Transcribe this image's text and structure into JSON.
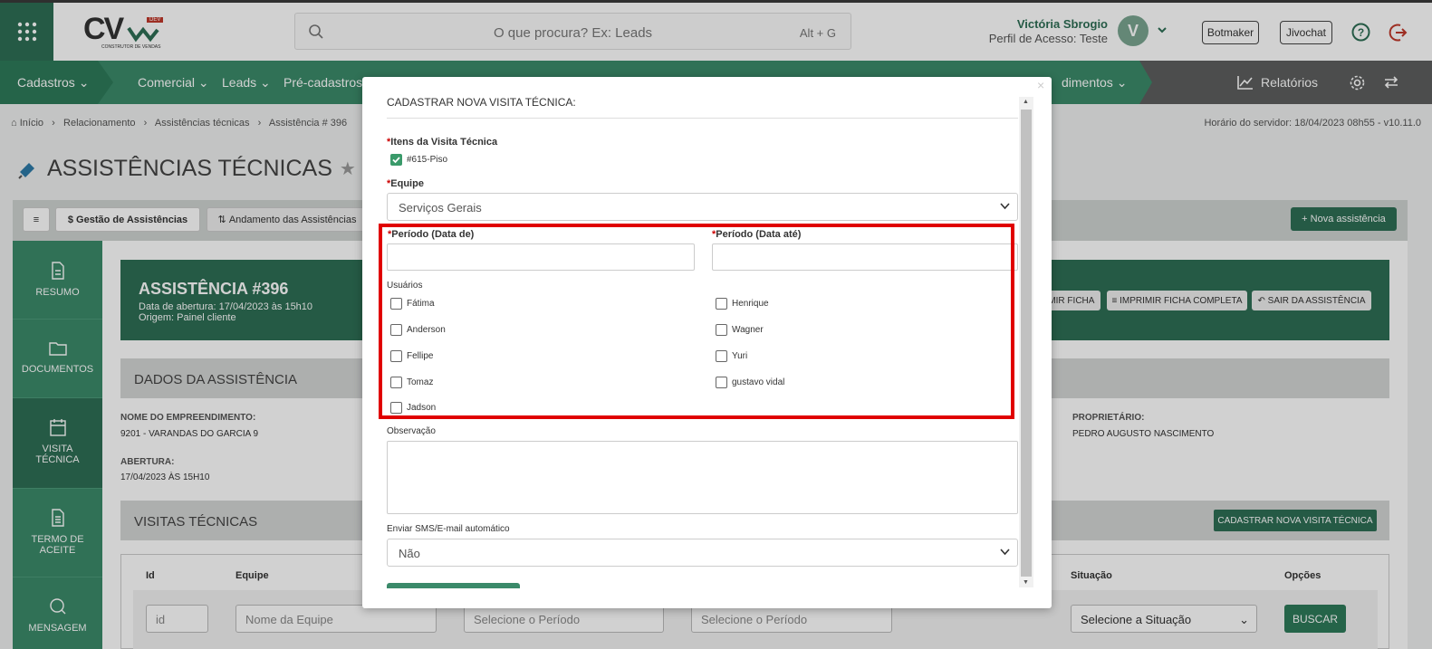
{
  "header": {
    "logo_text": "CV",
    "logo_tag": "DEV",
    "logo_sub": "CONSTRUTOR DE VENDAS",
    "search_placeholder": "O que procura? Ex: Leads",
    "search_shortcut": "Alt + G",
    "user_name": "Victória Sbrogio",
    "user_profile": "Perfil de Acesso: Teste",
    "avatar_letter": "V",
    "btn_botmaker": "Botmaker",
    "btn_jivochat": "Jivochat"
  },
  "nav": {
    "cadastros": "Cadastros",
    "comercial": "Comercial",
    "leads": "Leads",
    "precadastros": "Pré-cadastros",
    "atendimentos": "dimentos",
    "relatorios": "Relatórios"
  },
  "breadcrumb": {
    "items": [
      "Início",
      "Relacionamento",
      "Assistências técnicas",
      "Assistência # 396"
    ],
    "server_time": "Horário do servidor: 18/04/2023 08h55 - v10.11.0"
  },
  "page": {
    "title": "ASSISTÊNCIAS TÉCNICAS"
  },
  "toolbar": {
    "gestao": "$ Gestão de Assistências",
    "andamento": "Andamento das Assistências",
    "nova": "+ Nova assistência"
  },
  "sidebar": {
    "resumo": "RESUMO",
    "documentos": "DOCUMENTOS",
    "visita1": "VISITA",
    "visita2": "TÉCNICA",
    "termo1": "TERMO DE",
    "termo2": "ACEITE",
    "mensagem": "MENSAGEM"
  },
  "banner": {
    "title": "ASSISTÊNCIA #396",
    "abertura": "Data de abertura: 17/04/2023 às 15h10",
    "origem": "Origem: Painel cliente",
    "btn_ficha": "IMIR FICHA",
    "btn_completa": "IMPRIMIR FICHA COMPLETA",
    "btn_sair": "SAIR DA ASSISTÊNCIA"
  },
  "dados": {
    "title": "DADOS DA ASSISTÊNCIA",
    "emp_label": "NOME DO EMPREENDIMENTO:",
    "emp_value": "9201 - VARANDAS DO GARCIA 9",
    "ab_label": "ABERTURA:",
    "ab_value": "17/04/2023 ÀS 15H10",
    "prop_label": "PROPRIETÁRIO:",
    "prop_value": "PEDRO AUGUSTO NASCIMENTO"
  },
  "visitas": {
    "title": "VISITAS TÉCNICAS",
    "btn": "CADASTRAR NOVA VISITA TÉCNICA",
    "cols": [
      "Id",
      "Equipe",
      "Situação",
      "Opções"
    ],
    "ph_id": "id",
    "ph_equipe": "Nome da Equipe",
    "ph_periodo": "Selecione o Período",
    "ph_situacao": "Selecione a Situação",
    "buscar": "BUSCAR"
  },
  "modal": {
    "title": "CADASTRAR NOVA VISITA TÉCNICA:",
    "itens_label": "Itens da Visita Técnica",
    "item1": "#615-Piso",
    "equipe_label": "Equipe",
    "equipe_value": "Serviços Gerais",
    "periodo_de": "Período (Data de)",
    "periodo_ate": "Período (Data até)",
    "usuarios_label": "Usuários",
    "users_left": [
      "Fátima",
      "Anderson",
      "Fellipe",
      "Tomaz",
      "Jadson"
    ],
    "users_right": [
      "Henrique",
      "Wagner",
      "Yuri",
      "gustavo vidal"
    ],
    "observacao_label": "Observação",
    "sms_label": "Enviar SMS/E-mail automático",
    "sms_value": "Não",
    "required_mark": "*"
  }
}
